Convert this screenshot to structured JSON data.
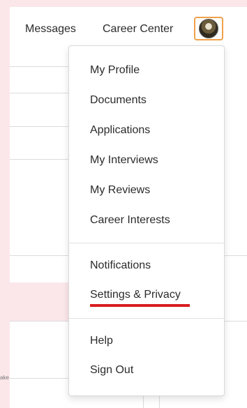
{
  "header": {
    "nav": {
      "messages_label": "Messages",
      "career_center_label": "Career Center"
    },
    "avatar_highlight_color": "#f0a14a"
  },
  "background": {
    "truncated_text": "ake"
  },
  "menu": {
    "items": [
      {
        "label": "My Profile"
      },
      {
        "label": "Documents"
      },
      {
        "label": "Applications"
      },
      {
        "label": "My Interviews"
      },
      {
        "label": "My Reviews"
      },
      {
        "label": "Career Interests"
      },
      {
        "label": "Notifications"
      },
      {
        "label": "Settings & Privacy",
        "highlighted": true
      },
      {
        "label": "Help"
      },
      {
        "label": "Sign Out"
      }
    ],
    "highlight_color": "#d81d20"
  }
}
